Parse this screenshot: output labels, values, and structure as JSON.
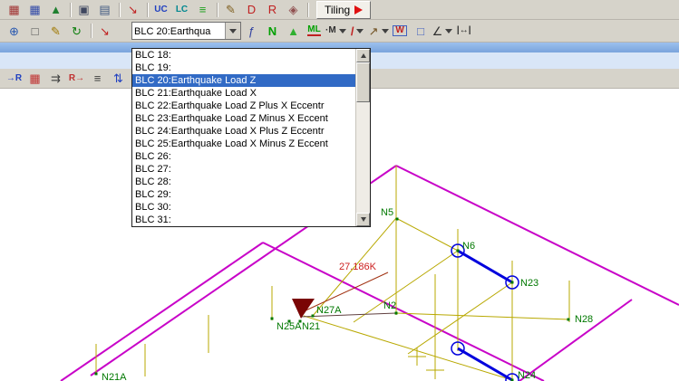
{
  "colors": {
    "toolbar_bg": "#d6d3ca",
    "canvas_bg": "#ffffff",
    "highlight": "#316ac5",
    "roof_outline": "#c803c8",
    "frame": "#b8a800",
    "selected_member": "#0000dd",
    "node_label": "#007800",
    "load_text": "#cc2020"
  },
  "toolbar1": {
    "items": [
      {
        "name": "input-table-icon",
        "glyph": "▦",
        "color": "#a03030"
      },
      {
        "name": "grid-settings-icon",
        "glyph": "▦",
        "color": "#3048a8"
      },
      {
        "name": "render-view-icon",
        "glyph": "▲",
        "color": "#208030"
      },
      {
        "sep": true
      },
      {
        "name": "new-window-icon",
        "glyph": "▣",
        "color": "#404860"
      },
      {
        "name": "tables-icon",
        "glyph": "▤",
        "color": "#405880"
      },
      {
        "sep": true
      },
      {
        "name": "assign-icon",
        "glyph": "↘",
        "color": "#c02020"
      },
      {
        "sep": true
      },
      {
        "name": "uc-icon",
        "glyph": "UC",
        "color": "#2040c0"
      },
      {
        "name": "lc-icon",
        "glyph": "LC",
        "color": "#008890"
      },
      {
        "name": "equal-icon",
        "glyph": "≡",
        "color": "#20a020"
      },
      {
        "sep": true
      },
      {
        "name": "edit-input-icon",
        "glyph": "✎",
        "color": "#806020"
      },
      {
        "name": "design-icon",
        "glyph": "D",
        "color": "#c02020"
      },
      {
        "name": "results-icon",
        "glyph": "R",
        "color": "#c02020"
      },
      {
        "name": "delete-results-icon",
        "glyph": "◈",
        "color": "#905050"
      },
      {
        "sep": true
      }
    ],
    "tiling": {
      "label": "Tiling"
    }
  },
  "toolbar2": {
    "items_left": [
      {
        "name": "zoom-in-icon",
        "glyph": "⊕",
        "color": "#2858b0"
      },
      {
        "name": "zoom-window-icon",
        "glyph": "□",
        "color": "#505050"
      },
      {
        "name": "edit-mode-icon",
        "glyph": "✎",
        "color": "#a07800"
      },
      {
        "name": "regenerate-icon",
        "glyph": "↻",
        "color": "#108010"
      },
      {
        "sep": true
      },
      {
        "name": "assign-load-icon",
        "glyph": "↘",
        "color": "#c02020"
      }
    ],
    "load_case_combo": {
      "value": "BLC 20:Earthqua"
    },
    "items_right": [
      {
        "name": "generate-loads-icon",
        "glyph": "ƒ",
        "color": "#3040a0"
      },
      {
        "name": "nodal-load-icon",
        "glyph": "N",
        "color": "#00a000",
        "bold": true
      },
      {
        "name": "support-icon",
        "glyph": "▲",
        "color": "#30b030"
      },
      {
        "name": "member-load-icon",
        "glyph": "ML",
        "color": "#00a000",
        "underline": "#c02020"
      },
      {
        "name": "moment-load-icon",
        "glyph": "·M",
        "color": "#303030",
        "caret": true
      },
      {
        "name": "line-load-icon",
        "glyph": "/",
        "color": "#c02020",
        "bold": true,
        "caret": true
      },
      {
        "name": "free-load-icon",
        "glyph": "↗",
        "color": "#705020",
        "caret": true
      },
      {
        "name": "wind-load-icon",
        "glyph": "W",
        "color": "#c02020",
        "box": "#4060c0"
      },
      {
        "name": "area-load-icon",
        "glyph": "□",
        "color": "#4060c0"
      },
      {
        "name": "dimension-icon",
        "glyph": "∠",
        "color": "#303030",
        "caret": true
      },
      {
        "name": "span-measure-icon",
        "glyph": "|↔|",
        "color": "#303030"
      }
    ]
  },
  "toolbar3": {
    "items": [
      {
        "name": "to-results-icon",
        "glyph": "→R",
        "color": "#2040c0"
      },
      {
        "name": "load-table-icon",
        "glyph": "▦",
        "color": "#c03030"
      },
      {
        "name": "node-sequence-icon",
        "glyph": "⇉",
        "color": "#404040"
      },
      {
        "name": "renumber-icon",
        "glyph": "R→",
        "color": "#c03030"
      },
      {
        "name": "list-icon",
        "glyph": "≡",
        "color": "#404040"
      },
      {
        "name": "sort-icon",
        "glyph": "⇅",
        "color": "#2040c0"
      }
    ]
  },
  "dropdown": {
    "selected_index": 2,
    "items": [
      "BLC 18:",
      "BLC 19:",
      "BLC 20:Earthquake Load Z",
      "BLC 21:Earthquake Load X",
      "BLC 22:Earthquake Load Z Plus X Eccentr",
      "BLC 23:Earthquake Load Z Minus X Eccent",
      "BLC 24:Earthquake Load X Plus Z Eccentr",
      "BLC 25:Earthquake Load X Minus Z Eccent",
      "BLC 26:",
      "BLC 27:",
      "BLC 28:",
      "BLC 29:",
      "BLC 30:",
      "BLC 31:"
    ]
  },
  "canvas": {
    "load_annotation": "27.186K",
    "nodes": [
      {
        "name": "N5",
        "dot": [
          438,
          144
        ],
        "label": [
          420,
          140
        ]
      },
      {
        "name": "N6",
        "dot": [
          505,
          179
        ],
        "label": [
          510,
          177
        ]
      },
      {
        "name": "N23",
        "dot": [
          565,
          214
        ],
        "label": [
          574,
          218
        ]
      },
      {
        "name": "N2",
        "dot": [
          437,
          248
        ],
        "label": [
          423,
          243
        ]
      },
      {
        "name": "N28",
        "dot": [
          627,
          255
        ],
        "label": [
          634,
          258
        ]
      },
      {
        "name": "N27A",
        "dot": [
          345,
          251
        ],
        "label": [
          349,
          248
        ]
      },
      {
        "name": "N25A",
        "dot": [
          319,
          257
        ],
        "label": [
          305,
          266
        ]
      },
      {
        "name": "N21",
        "dot": [
          331,
          257
        ],
        "label": [
          333,
          266
        ]
      },
      {
        "name": "N24",
        "dot": [
          565,
          322
        ],
        "label": [
          571,
          320
        ]
      },
      {
        "name": "N21A",
        "dot": [
          106,
          315
        ],
        "label": [
          112,
          322
        ]
      }
    ]
  }
}
